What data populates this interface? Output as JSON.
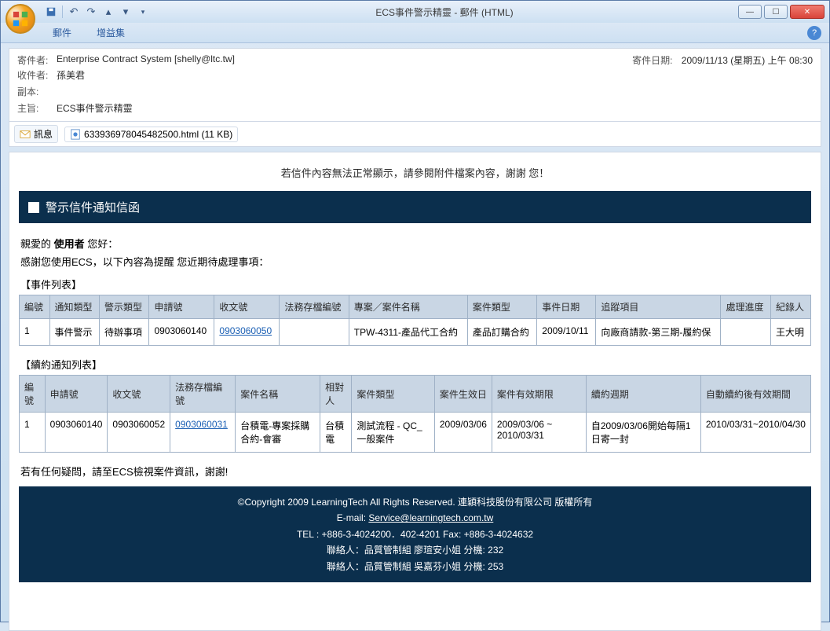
{
  "window": {
    "title": "ECS事件警示精靈 - 郵件 (HTML)"
  },
  "ribbon": {
    "tab1": "郵件",
    "tab2": "增益集"
  },
  "header": {
    "from_label": "寄件者:",
    "from_value": "Enterprise Contract System [shelly@ltc.tw]",
    "sent_label": "寄件日期:",
    "sent_value": "2009/11/13 (星期五) 上午 08:30",
    "to_label": "收件者:",
    "to_value": "孫美君",
    "cc_label": "副本:",
    "cc_value": "",
    "subject_label": "主旨:",
    "subject_value": "ECS事件警示精靈"
  },
  "attach": {
    "tab_label": "訊息",
    "file_label": "633936978045482500.html (11 KB)"
  },
  "body": {
    "top_notice": "若信件內容無法正常顯示，請參閱附件檔案內容，謝謝 您！",
    "banner_title": "警示信件通知信函",
    "greeting_prefix": "親愛的 ",
    "greeting_user": "使用者",
    "greeting_suffix": " 您好：",
    "subline": "感謝您使用ECS，以下內容為提醒 您近期待處理事項：",
    "section1": "【事件列表】",
    "table1_headers": {
      "c0": "編號",
      "c1": "通知類型",
      "c2": "警示類型",
      "c3": "申請號",
      "c4": "收文號",
      "c5": "法務存檔編號",
      "c6": "專案／案件名稱",
      "c7": "案件類型",
      "c8": "事件日期",
      "c9": "追蹤項目",
      "c10": "處理進度",
      "c11": "紀錄人"
    },
    "table1_row": {
      "c0": "1",
      "c1": "事件警示",
      "c2": "待辦事項",
      "c3": "0903060140",
      "c4": "0903060050",
      "c5": "",
      "c6": "TPW-4311-產品代工合約",
      "c7": "產品訂購合約",
      "c8": "2009/10/11",
      "c9": "向廠商請款-第三期-履約保",
      "c10": "",
      "c11": "王大明"
    },
    "section2": "【續約通知列表】",
    "table2_headers": {
      "c0": "編號",
      "c1": "申請號",
      "c2": "收文號",
      "c3": "法務存檔編號",
      "c4": "案件名稱",
      "c5": "相對人",
      "c6": "案件類型",
      "c7": "案件生效日",
      "c8": "案件有效期限",
      "c9": "續約週期",
      "c10": "自動續約後有效期間"
    },
    "table2_row": {
      "c0": "1",
      "c1": "0903060140",
      "c2": "0903060052",
      "c3": "0903060031",
      "c4": "台積電-專案採購合約-會審",
      "c5": "台積電",
      "c6": "測試流程 - QC_一般案件",
      "c7": "2009/03/06",
      "c8": "2009/03/06 ~ 2010/03/31",
      "c9": "自2009/03/06開始每隔1日寄一封",
      "c10": "2010/03/31~2010/04/30"
    },
    "closing": "若有任何疑問，請至ECS檢視案件資訊，謝謝!",
    "footer": {
      "line1": "©Copyright 2009 LearningTech All Rights Reserved. 連穎科技股份有限公司 版權所有",
      "line2_prefix": "E-mail: ",
      "line2_link": "Service@learningtech.com.tw",
      "line3": "TEL : +886-3-4024200．402-4201 Fax: +886-3-4024632",
      "line4": "聯絡人：品質管制組 廖瑄安小姐 分機: 232",
      "line5": "聯絡人：品質管制組 吳嘉芬小姐 分機: 253"
    }
  }
}
